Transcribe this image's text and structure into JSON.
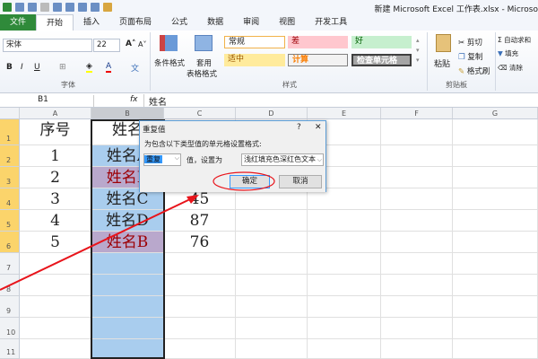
{
  "window": {
    "title": "新建 Microsoft Excel 工作表.xlsx - Microso"
  },
  "tabs": [
    "文件",
    "开始",
    "插入",
    "页面布局",
    "公式",
    "数据",
    "审阅",
    "视图",
    "开发工具"
  ],
  "ribbon": {
    "font_name": "宋体",
    "font_size": "22",
    "font_group": "字体",
    "cond_format": "条件格式",
    "table_format_1": "套用",
    "table_format_2": "表格格式",
    "styles": {
      "normal": "常规",
      "bad": "差",
      "good": "好",
      "neutral": "适中",
      "calc": "计算",
      "check": "检查单元格",
      "label": "样式"
    },
    "clipboard": {
      "paste": "粘贴",
      "cut": "剪切",
      "copy": "复制",
      "painter": "格式刷",
      "label": "剪贴板"
    },
    "edit": {
      "autosum": "自动求和",
      "fill": "填充",
      "clear": "清除"
    }
  },
  "formula_bar": {
    "name_box": "B1",
    "fx": "fx",
    "content": "姓名"
  },
  "columns": [
    "A",
    "B",
    "C",
    "D",
    "E",
    "F",
    "G"
  ],
  "rows": [
    "1",
    "2",
    "3",
    "4",
    "5",
    "6",
    "7",
    "8",
    "9",
    "10",
    "11"
  ],
  "cells": [
    [
      "序号",
      "姓名",
      ""
    ],
    [
      "1",
      "姓名A",
      ""
    ],
    [
      "2",
      "姓名B",
      ""
    ],
    [
      "3",
      "姓名C",
      "45"
    ],
    [
      "4",
      "姓名D",
      "87"
    ],
    [
      "5",
      "姓名B",
      "76"
    ]
  ],
  "dialog": {
    "title": "重复值",
    "help": "?",
    "close": "✕",
    "prompt": "为包含以下类型值的单元格设置格式:",
    "type": "重复",
    "mid_label": "值，设置为",
    "format": "浅红填充色深红色文本",
    "ok": "确定",
    "cancel": "取消"
  },
  "colors": {
    "selection": "#a9cdee",
    "duplicate_fill": "#b9a8cc",
    "duplicate_text": "#9c0006",
    "annotation": "#e8141b"
  }
}
